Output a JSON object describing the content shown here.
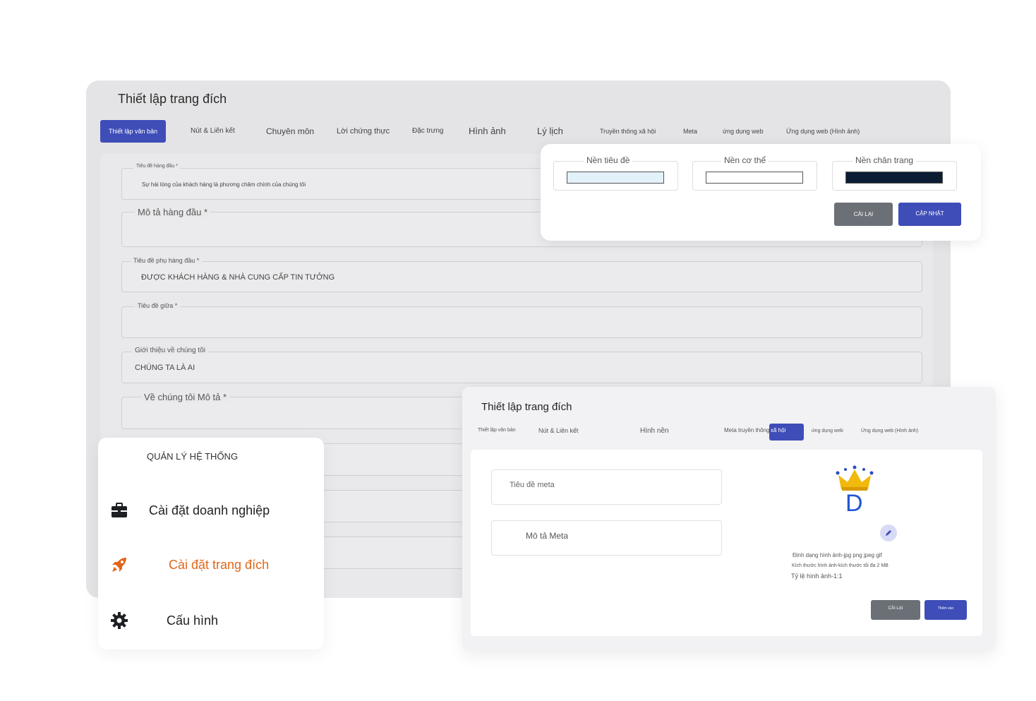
{
  "main": {
    "title": "Thiết lập trang đích",
    "tabs": [
      "Thiết lập văn bản",
      "Nút & Liên kết",
      "Chuyên môn",
      "Lời chứng thực",
      "Đặc trưng",
      "Hình ảnh",
      "Lý lịch",
      "Truyền thông xã hội",
      "Meta",
      "ứng dụng web",
      "Ứng dụng web (Hình ảnh)"
    ],
    "fields": {
      "top_title_label": "Tiêu đề hàng đầu *",
      "top_title_value": "Sự hài lòng của khách hàng là phương châm chính của chúng tôi",
      "top_desc_label": "Mô tả hàng đầu *",
      "top_subtitle_label": "Tiêu đề phụ hàng đầu *",
      "top_subtitle_value": "ĐƯỢC KHÁCH HÀNG & NHÀ CUNG CẤP TIN TƯỞNG",
      "middle_title_label": "Tiêu đề giữa *",
      "about_label": "Giới thiệu về chúng tôi",
      "about_value": "CHÚNG TA LÀ AI",
      "about_desc_label": "Về chúng tôi Mô tả *"
    }
  },
  "colors": {
    "header_label": "Nền tiêu đề",
    "body_label": "Nền cơ thể",
    "footer_label": "Nền chân trang",
    "header_color": "#e3f1fb",
    "body_color": "#ffffff",
    "footer_color": "#0b1d33",
    "reset": "CÀI LẠI",
    "update": "CẬP NHẬT"
  },
  "menu": {
    "heading": "QUẢN LÝ HỆ THỐNG",
    "items": [
      {
        "label": "Cài đặt doanh nghiệp",
        "icon": "briefcase-icon"
      },
      {
        "label": "Cài đặt trang đích",
        "icon": "rocket-icon"
      },
      {
        "label": "Cấu hình",
        "icon": "gear-icon"
      }
    ],
    "active_color": "#e0661a"
  },
  "meta": {
    "title": "Thiết lập trang đích",
    "tabs": [
      "Thiết lập văn bản",
      "Nút & Liên kết",
      "Hình nền",
      "Meta truyền thông",
      "xã hội",
      "ứng dụng web",
      "Ứng dụng web (Hình ảnh)"
    ],
    "meta_title_placeholder": "Tiêu đề meta",
    "meta_desc_placeholder": "Mô tả Meta",
    "logo_letter": "D",
    "image_format": "Định dạng hình ảnh-jpg png jpeg gif",
    "image_size": "Kích thước hình ảnh-kích thước tối đa 2 MB",
    "image_ratio": "Tỷ lệ hình ảnh-1:1",
    "reset": "CÀI LẠI",
    "save": "Thêm vào"
  },
  "accent_color": "#3f4db8"
}
